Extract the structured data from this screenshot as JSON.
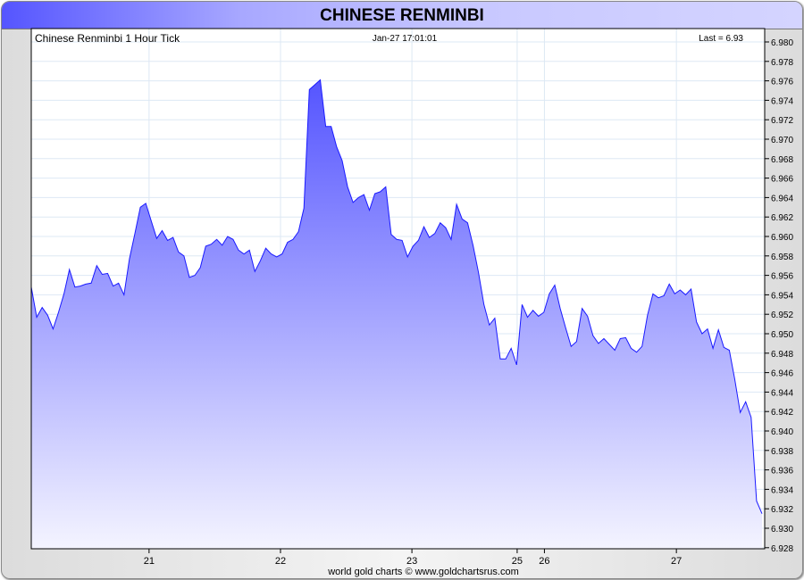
{
  "title": "CHINESE RENMINBI",
  "colors": {
    "line": "#1a1aff",
    "fill_top": "#5555ff",
    "fill_bottom": "#f4f4ff",
    "grid": "#dde8f4"
  },
  "chart_data": {
    "type": "area",
    "title": "Chinese Renminbi 1 Hour Tick",
    "timestamp": "Jan-27  17:01:01",
    "last_label": "Last = 6.93",
    "footer": "world gold charts © www.goldchartsrus.com",
    "ylim": [
      6.928,
      6.981
    ],
    "y_ticks": [
      "6.980",
      "6.978",
      "6.976",
      "6.974",
      "6.972",
      "6.970",
      "6.968",
      "6.966",
      "6.964",
      "6.962",
      "6.960",
      "6.958",
      "6.956",
      "6.954",
      "6.952",
      "6.950",
      "6.948",
      "6.946",
      "6.944",
      "6.942",
      "6.940",
      "6.938",
      "6.936",
      "6.934",
      "6.932",
      "6.930",
      "6.928"
    ],
    "x_ticks": [
      {
        "label": "21",
        "index": 21.6
      },
      {
        "label": "22",
        "index": 45.7
      },
      {
        "label": "23",
        "index": 69.8
      },
      {
        "label": "25",
        "index": 89.1
      },
      {
        "label": "26",
        "index": 94.1
      },
      {
        "label": "27",
        "index": 118.3
      }
    ],
    "values": [
      6.9548,
      6.9517,
      6.9527,
      6.9519,
      6.9505,
      6.9522,
      6.9541,
      6.9566,
      6.9548,
      6.9549,
      6.9551,
      6.9552,
      6.957,
      6.9561,
      6.9562,
      6.9549,
      6.9552,
      6.954,
      6.9577,
      6.9603,
      6.963,
      6.9634,
      6.9616,
      6.9598,
      6.9606,
      6.9596,
      6.9599,
      6.9584,
      6.958,
      6.9558,
      6.956,
      6.9568,
      6.959,
      6.9592,
      6.9597,
      6.9591,
      6.96,
      6.9597,
      6.9586,
      6.9582,
      6.9586,
      6.9564,
      6.9575,
      6.9588,
      6.9582,
      6.9579,
      6.9582,
      6.9594,
      6.9597,
      6.9605,
      6.9629,
      6.9751,
      6.9756,
      6.9761,
      6.9713,
      6.9713,
      6.9692,
      6.9678,
      6.9651,
      6.9635,
      6.964,
      6.9643,
      6.9627,
      6.9644,
      6.9646,
      6.9651,
      6.9602,
      6.9597,
      6.9596,
      6.9579,
      6.959,
      6.9596,
      6.961,
      6.9599,
      6.9603,
      6.9614,
      6.9609,
      6.9597,
      6.9633,
      6.9618,
      6.9614,
      6.9591,
      6.9563,
      6.953,
      6.9509,
      6.9516,
      6.9474,
      6.9474,
      6.9485,
      6.9468,
      6.953,
      6.9517,
      6.9524,
      6.9518,
      6.9522,
      6.9541,
      6.955,
      6.9526,
      6.9506,
      6.9487,
      6.9492,
      6.9526,
      6.9518,
      6.9498,
      6.949,
      6.9495,
      6.9489,
      6.9483,
      6.9495,
      6.9496,
      6.9485,
      6.9481,
      6.9487,
      6.9519,
      6.9541,
      6.9537,
      6.9539,
      6.9551,
      6.9541,
      6.9545,
      6.954,
      6.9546,
      6.9512,
      6.95,
      6.9505,
      6.9485,
      6.9504,
      6.9486,
      6.9483,
      6.9453,
      6.9419,
      6.943,
      6.9414,
      6.9328,
      6.9315
    ]
  }
}
